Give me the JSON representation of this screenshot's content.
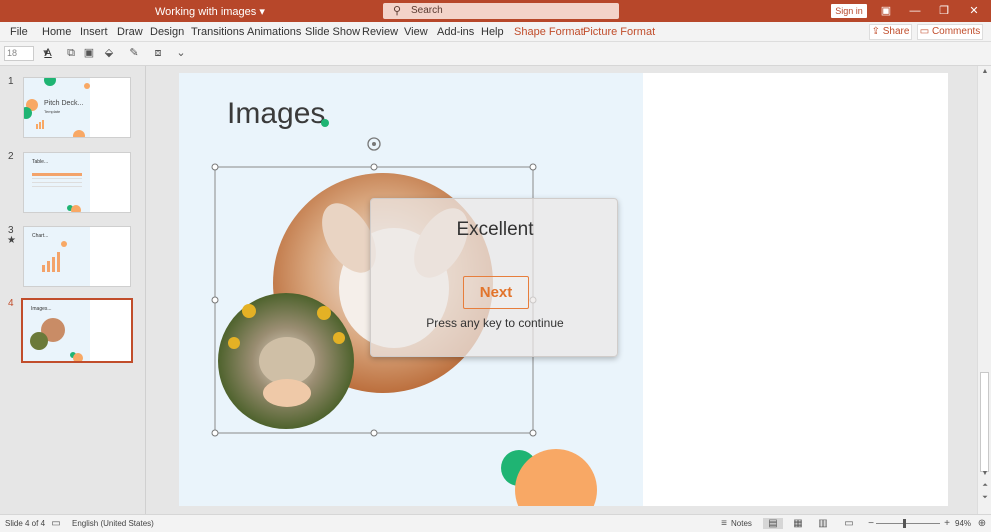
{
  "app": {
    "doc_title": "Working with images",
    "search_placeholder": "Search",
    "sign_in": "Sign in"
  },
  "ribbon": {
    "tabs": [
      "File",
      "Home",
      "Insert",
      "Draw",
      "Design",
      "Transitions",
      "Animations",
      "Slide Show",
      "Review",
      "View",
      "Add-ins",
      "Help",
      "Shape Format",
      "Picture Format"
    ],
    "share": "Share",
    "comments": "Comments"
  },
  "toolbar": {
    "font_size": "18"
  },
  "thumbnails": [
    {
      "num": "1",
      "title": "Pitch Deck...",
      "subtitle": "Template"
    },
    {
      "num": "2",
      "title": "Table..."
    },
    {
      "num": "3",
      "title": "Chart..."
    },
    {
      "num": "4",
      "title": "Images..."
    }
  ],
  "slide": {
    "title": "Images"
  },
  "popup": {
    "heading": "Excellent",
    "next_label": "Next",
    "hint": "Press any key to continue"
  },
  "status": {
    "slide_indicator": "Slide 4 of 4",
    "language": "English (United States)",
    "notes": "Notes",
    "zoom": "94%"
  },
  "colors": {
    "brand": "#b7472a",
    "accent_orange": "#f8a865",
    "accent_green": "#1fb473"
  }
}
